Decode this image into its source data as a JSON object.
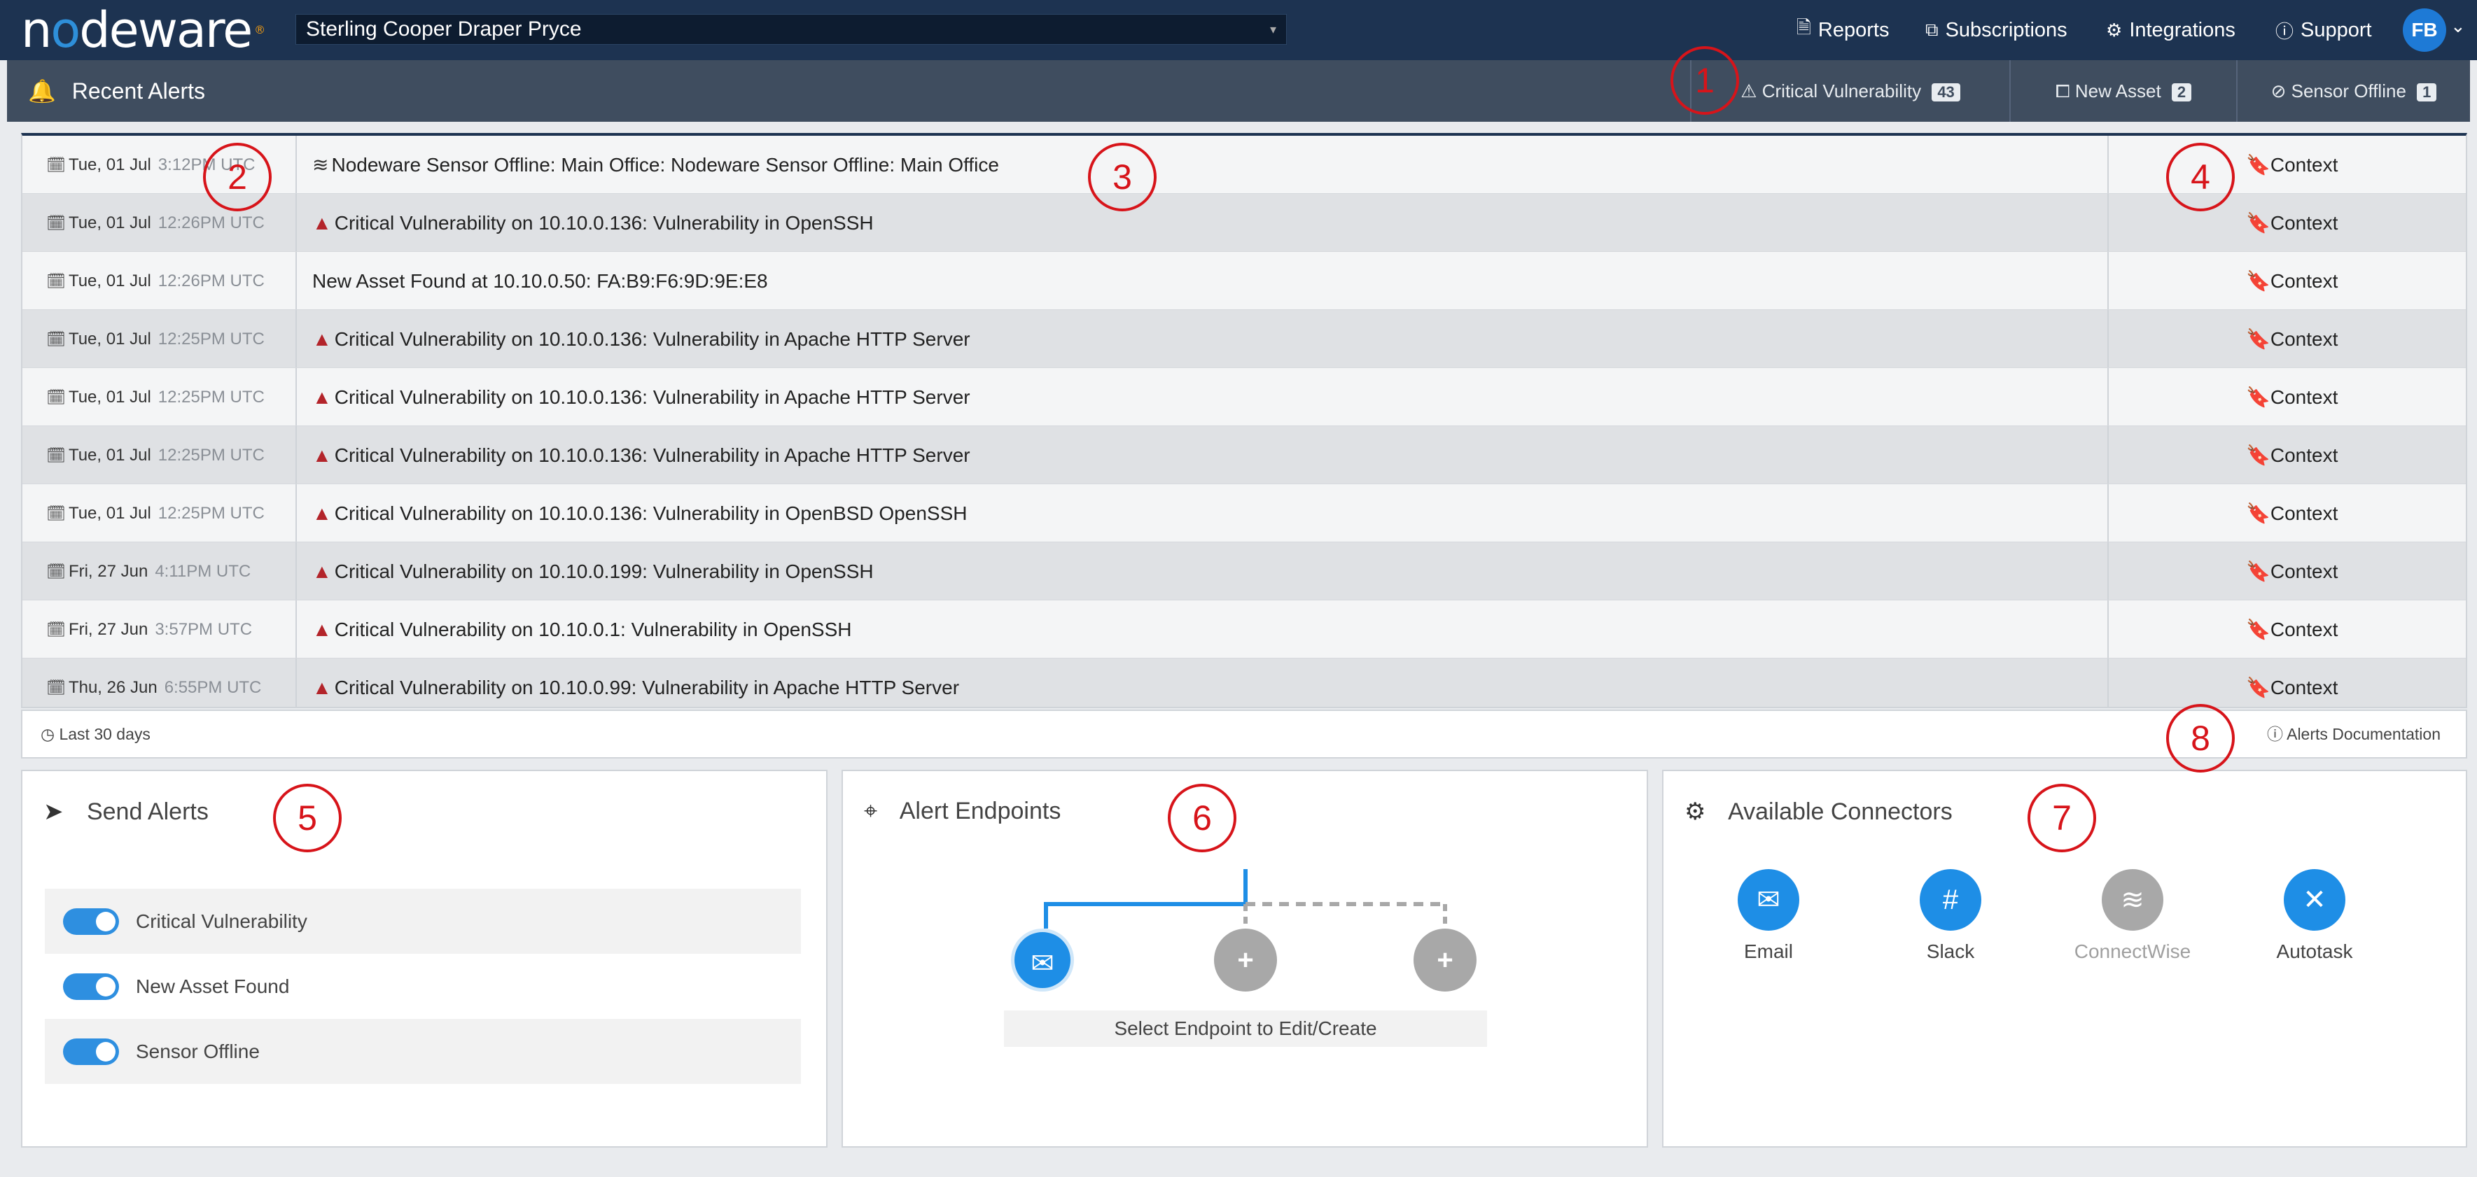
{
  "header": {
    "logo_text": "nodeware",
    "org_name": "Sterling Cooper Draper Pryce",
    "nav": [
      {
        "label": "Reports",
        "icon": "document-icon"
      },
      {
        "label": "Subscriptions",
        "icon": "cubes-icon"
      },
      {
        "label": "Integrations",
        "icon": "gears-icon"
      },
      {
        "label": "Support",
        "icon": "help-circle-icon"
      }
    ],
    "avatar_initials": "FB"
  },
  "alert_bar": {
    "title": "Recent Alerts",
    "filters": [
      {
        "label": "Critical Vulnerability",
        "count": "43",
        "icon": "warning-icon"
      },
      {
        "label": "New Asset",
        "count": "2",
        "icon": "devices-icon"
      },
      {
        "label": "Sensor Offline",
        "count": "1",
        "icon": "wifi-off-icon"
      }
    ]
  },
  "alerts": [
    {
      "date": "Tue, 01 Jul",
      "time": "3:12PM UTC",
      "type": "sensor",
      "message": "Nodeware Sensor Offline: Main Office: Nodeware Sensor Offline: Main Office",
      "context": "Context"
    },
    {
      "date": "Tue, 01 Jul",
      "time": "12:26PM UTC",
      "type": "critical",
      "message": "Critical Vulnerability on 10.10.0.136: Vulnerability in OpenSSH",
      "context": "Context"
    },
    {
      "date": "Tue, 01 Jul",
      "time": "12:26PM UTC",
      "type": "asset",
      "message": "New Asset Found at 10.10.0.50: FA:B9:F6:9D:9E:E8",
      "context": "Context"
    },
    {
      "date": "Tue, 01 Jul",
      "time": "12:25PM UTC",
      "type": "critical",
      "message": "Critical Vulnerability on 10.10.0.136: Vulnerability in Apache HTTP Server",
      "context": "Context"
    },
    {
      "date": "Tue, 01 Jul",
      "time": "12:25PM UTC",
      "type": "critical",
      "message": "Critical Vulnerability on 10.10.0.136: Vulnerability in Apache HTTP Server",
      "context": "Context"
    },
    {
      "date": "Tue, 01 Jul",
      "time": "12:25PM UTC",
      "type": "critical",
      "message": "Critical Vulnerability on 10.10.0.136: Vulnerability in Apache HTTP Server",
      "context": "Context"
    },
    {
      "date": "Tue, 01 Jul",
      "time": "12:25PM UTC",
      "type": "critical",
      "message": "Critical Vulnerability on 10.10.0.136: Vulnerability in OpenBSD OpenSSH",
      "context": "Context"
    },
    {
      "date": "Fri, 27 Jun",
      "time": "4:11PM UTC",
      "type": "critical",
      "message": "Critical Vulnerability on 10.10.0.199: Vulnerability in OpenSSH",
      "context": "Context"
    },
    {
      "date": "Fri, 27 Jun",
      "time": "3:57PM UTC",
      "type": "critical",
      "message": "Critical Vulnerability on 10.10.0.1: Vulnerability in OpenSSH",
      "context": "Context"
    },
    {
      "date": "Thu, 26 Jun",
      "time": "6:55PM UTC",
      "type": "critical",
      "message": "Critical Vulnerability on 10.10.0.99: Vulnerability in Apache HTTP Server",
      "context": "Context"
    }
  ],
  "table_footer": {
    "range": "Last 30 days",
    "docs_link": "Alerts Documentation"
  },
  "send_alerts": {
    "title": "Send Alerts",
    "toggles": [
      {
        "label": "Critical Vulnerability",
        "enabled": true
      },
      {
        "label": "New Asset Found",
        "enabled": true
      },
      {
        "label": "Sensor Offline",
        "enabled": true
      }
    ]
  },
  "endpoints": {
    "title": "Alert Endpoints",
    "caption": "Select Endpoint to Edit/Create",
    "add_symbol": "+"
  },
  "connectors": {
    "title": "Available Connectors",
    "items": [
      {
        "label": "Email",
        "color": "#1e8ee6",
        "enabled": true
      },
      {
        "label": "Slack",
        "color": "#1e8ee6",
        "enabled": true
      },
      {
        "label": "ConnectWise",
        "color": "#a8a8a8",
        "enabled": false
      },
      {
        "label": "Autotask",
        "color": "#1e8ee6",
        "enabled": true
      }
    ]
  },
  "markers": [
    "1",
    "2",
    "3",
    "4",
    "5",
    "6",
    "7",
    "8"
  ],
  "colors": {
    "navbar": "#1d3351",
    "alert_bar": "#3f4d5f",
    "accent": "#1e8ee6",
    "critical": "#b3242a",
    "marker": "#d7141a"
  }
}
